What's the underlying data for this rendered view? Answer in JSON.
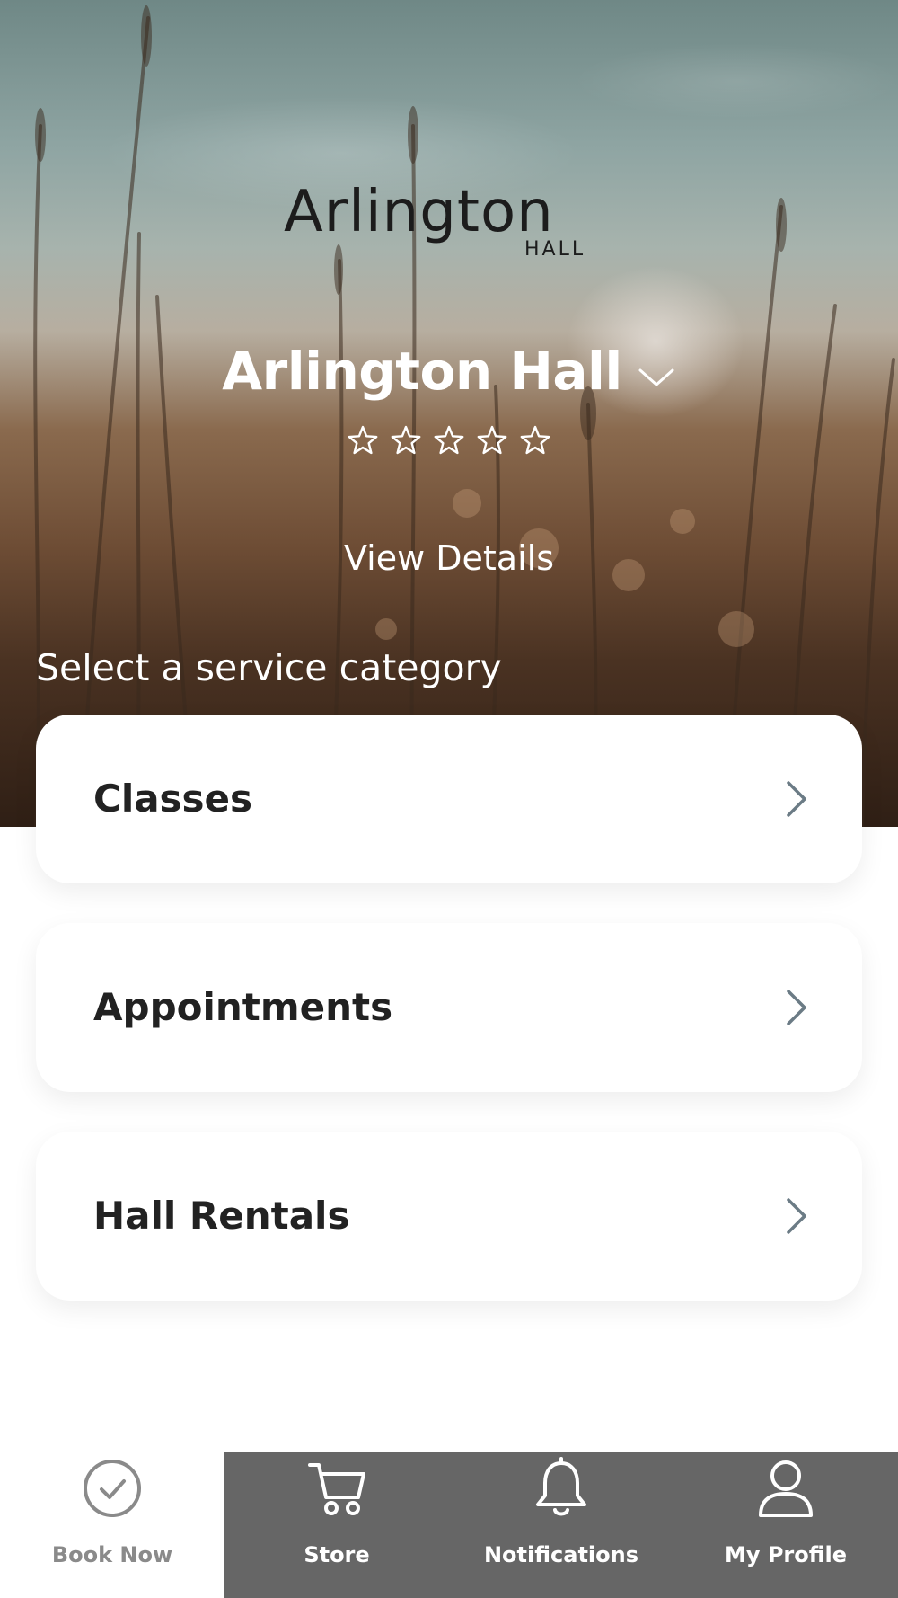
{
  "header": {
    "logo_text": "Arlington",
    "logo_subtext": "HALL",
    "venue_name": "Arlington Hall",
    "rating": 0,
    "rating_max": 5,
    "view_details_label": "View Details"
  },
  "services": {
    "title": "Select a service category",
    "items": [
      {
        "label": "Classes"
      },
      {
        "label": "Appointments"
      },
      {
        "label": "Hall Rentals"
      }
    ]
  },
  "tabbar": {
    "items": [
      {
        "label": "Book Now",
        "icon": "check-circle-icon",
        "active": true
      },
      {
        "label": "Store",
        "icon": "cart-icon",
        "active": false
      },
      {
        "label": "Notifications",
        "icon": "bell-icon",
        "active": false
      },
      {
        "label": "My Profile",
        "icon": "user-icon",
        "active": false
      }
    ]
  },
  "colors": {
    "tabbar_inactive_bg": "#666666",
    "active_tab_text": "#8a8a8a",
    "card_text": "#222222",
    "chevron": "#6b7b85"
  }
}
